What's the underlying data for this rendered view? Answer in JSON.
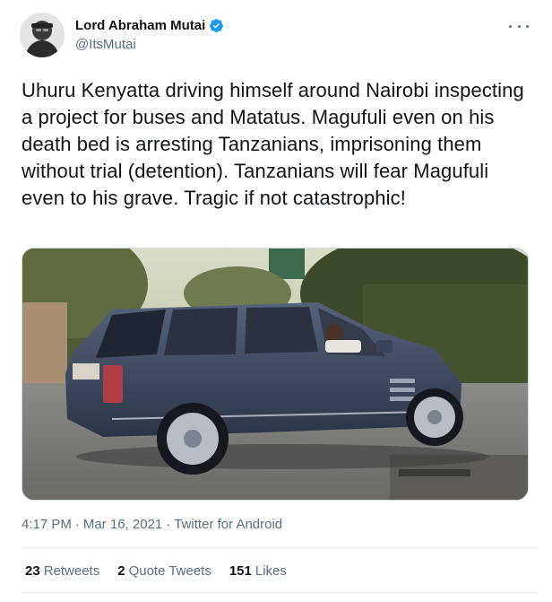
{
  "author": {
    "display_name": "Lord Abraham Mutai",
    "handle": "@ItsMutai",
    "verified": true
  },
  "tweet": {
    "text": "Uhuru Kenyatta driving himself around Nairobi inspecting a project for buses and Matatus. Magufuli even on his death bed is arresting Tanzanians, imprisoning them without trial (detention). Tanzanians will fear Magufuli even to his grave. Tragic if not catastrophic!",
    "time": "4:17 PM",
    "separator": "·",
    "date": "Mar 16, 2021",
    "source": "Twitter for Android"
  },
  "stats": {
    "retweets_count": "23",
    "retweets_label": "Retweets",
    "quotes_count": "2",
    "quotes_label": "Quote Tweets",
    "likes_count": "151",
    "likes_label": "Likes"
  },
  "colors": {
    "verified_blue": "#1d9bf0",
    "secondary_text": "#5b7083",
    "primary_text": "#0f1419",
    "car_body": "#3f4b62"
  },
  "icons": {
    "verified": "verified-badge-icon",
    "more": "more-options-icon"
  }
}
